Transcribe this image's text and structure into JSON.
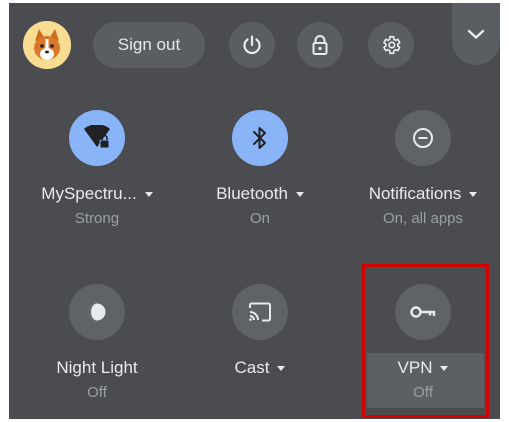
{
  "topbar": {
    "sign_out_label": "Sign out",
    "avatar_icon": "corgi-avatar",
    "power_icon": "power-icon",
    "lock_icon": "lock-icon",
    "settings_icon": "gear-icon",
    "collapse_icon": "chevron-down-icon"
  },
  "tiles": {
    "wifi": {
      "label": "MySpectru...",
      "status": "Strong",
      "icon": "wifi-lock-icon",
      "active": true
    },
    "bluetooth": {
      "label": "Bluetooth",
      "status": "On",
      "icon": "bluetooth-icon",
      "active": true
    },
    "notifications": {
      "label": "Notifications",
      "status": "On, all apps",
      "icon": "do-not-disturb-icon",
      "active": false
    },
    "night_light": {
      "label": "Night Light",
      "status": "Off",
      "icon": "night-light-icon",
      "active": false
    },
    "cast": {
      "label": "Cast",
      "status": "",
      "icon": "cast-icon",
      "active": false
    },
    "vpn": {
      "label": "VPN",
      "status": "Off",
      "icon": "key-icon",
      "active": false
    }
  },
  "colors": {
    "panel_bg": "#4a4c4f",
    "active_tile": "#8ab4f8",
    "inactive_tile": "#5f6368",
    "highlight": "#d50000"
  }
}
